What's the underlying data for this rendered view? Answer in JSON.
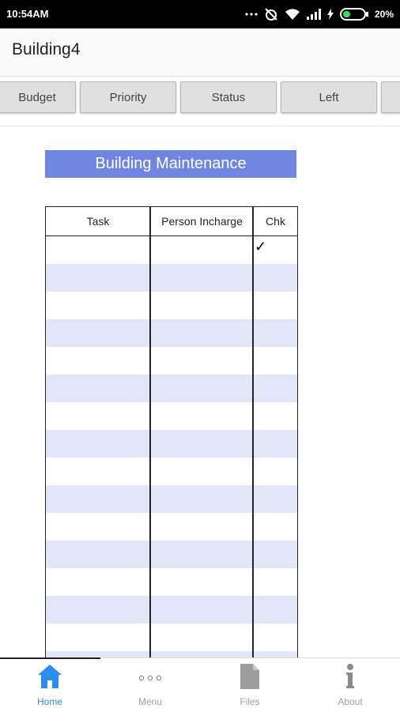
{
  "status_bar": {
    "time": "10:54AM",
    "battery": "20%"
  },
  "app_bar": {
    "title": "Building4"
  },
  "toolbar": {
    "buttons": [
      {
        "label": "Budget"
      },
      {
        "label": "Priority"
      },
      {
        "label": "Status"
      },
      {
        "label": "Left"
      },
      {
        "label": ""
      }
    ]
  },
  "sheet": {
    "title": "Building Maintenance",
    "columns": [
      "Task",
      "Person Incharge",
      "Chk"
    ],
    "checked_mark": "✓"
  },
  "bottom_nav": {
    "items": [
      {
        "label": "Home",
        "icon": "home-icon",
        "active": true
      },
      {
        "label": "Menu",
        "icon": "menu-dots-icon",
        "active": false
      },
      {
        "label": "Files",
        "icon": "file-icon",
        "active": false
      },
      {
        "label": "About",
        "icon": "info-icon",
        "active": false
      }
    ]
  },
  "colors": {
    "header_blue": "#6f86e0",
    "row_stripe": "#e3e6f7",
    "active_nav": "#2c8cf0"
  }
}
